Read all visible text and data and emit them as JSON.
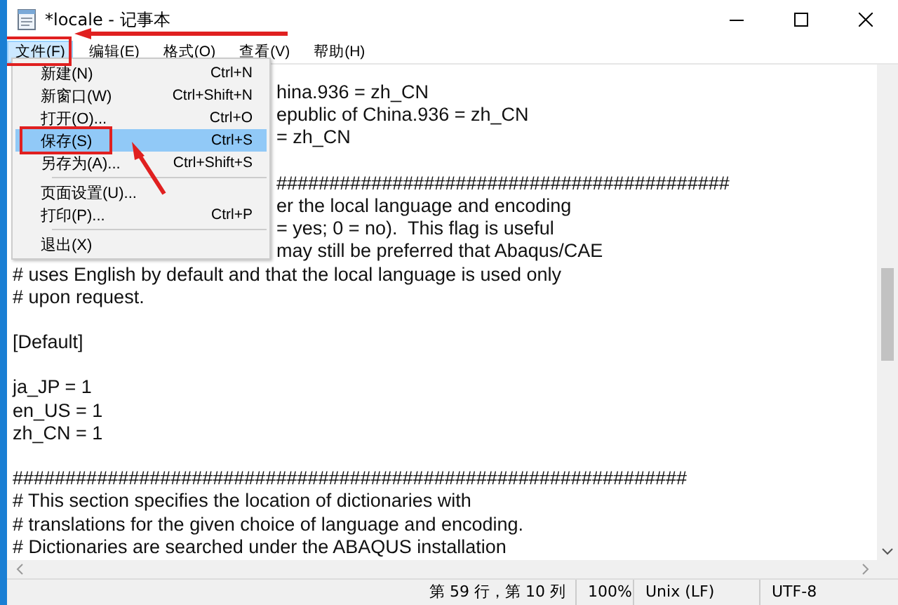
{
  "window": {
    "title": "*locale - 记事本"
  },
  "menubar": [
    {
      "label": "文件(F)",
      "selected": true
    },
    {
      "label": "编辑(E)",
      "selected": false
    },
    {
      "label": "格式(O)",
      "selected": false
    },
    {
      "label": "查看(V)",
      "selected": false
    },
    {
      "label": "帮助(H)",
      "selected": false
    }
  ],
  "file_menu": {
    "items": [
      {
        "kind": "item",
        "label": "新建(N)",
        "shortcut": "Ctrl+N",
        "selected": false
      },
      {
        "kind": "item",
        "label": "新窗口(W)",
        "shortcut": "Ctrl+Shift+N",
        "selected": false
      },
      {
        "kind": "item",
        "label": "打开(O)...",
        "shortcut": "Ctrl+O",
        "selected": false
      },
      {
        "kind": "item",
        "label": "保存(S)",
        "shortcut": "Ctrl+S",
        "selected": true
      },
      {
        "kind": "item",
        "label": "另存为(A)...",
        "shortcut": "Ctrl+Shift+S",
        "selected": false
      },
      {
        "kind": "separator"
      },
      {
        "kind": "item",
        "label": "页面设置(U)...",
        "selected": false
      },
      {
        "kind": "item",
        "label": "打印(P)...",
        "shortcut": "Ctrl+P",
        "selected": false
      },
      {
        "kind": "separator"
      },
      {
        "kind": "item",
        "label": "退出(X)",
        "selected": false
      }
    ]
  },
  "editor": {
    "lines": [
      {
        "kind": "partial",
        "text": "hina.936 = zh_CN"
      },
      {
        "kind": "partial",
        "text": "epublic of China.936 = zh_CN"
      },
      {
        "kind": "partial",
        "text": "= zh_CN"
      },
      {
        "kind": "blank"
      },
      {
        "kind": "partial",
        "text": "###########################################"
      },
      {
        "kind": "partial",
        "text": "er the local language and encoding"
      },
      {
        "kind": "partial",
        "text": "= yes; 0 = no).  This flag is useful"
      },
      {
        "kind": "partial",
        "text": "may still be preferred that Abaqus/CAE"
      },
      {
        "kind": "full",
        "text": "# uses English by default and that the local language is used only"
      },
      {
        "kind": "full",
        "text": "# upon request."
      },
      {
        "kind": "blank"
      },
      {
        "kind": "full",
        "text": "[Default]"
      },
      {
        "kind": "blank"
      },
      {
        "kind": "full",
        "text": "ja_JP = 1"
      },
      {
        "kind": "full",
        "text": "en_US = 1"
      },
      {
        "kind": "full",
        "text": "zh_CN = 1"
      },
      {
        "kind": "blank"
      },
      {
        "kind": "full",
        "text": "################################################################"
      },
      {
        "kind": "full",
        "text": "# This section specifies the location of dictionaries with"
      },
      {
        "kind": "full",
        "text": "# translations for the given choice of language and encoding."
      },
      {
        "kind": "full",
        "text": "# Dictionaries are searched under the ABAQUS installation"
      }
    ]
  },
  "status_bar": {
    "position": "第 59 行，第 10 列",
    "zoom": "100%",
    "line_ending": "Unix (LF)",
    "encoding": "UTF-8"
  }
}
